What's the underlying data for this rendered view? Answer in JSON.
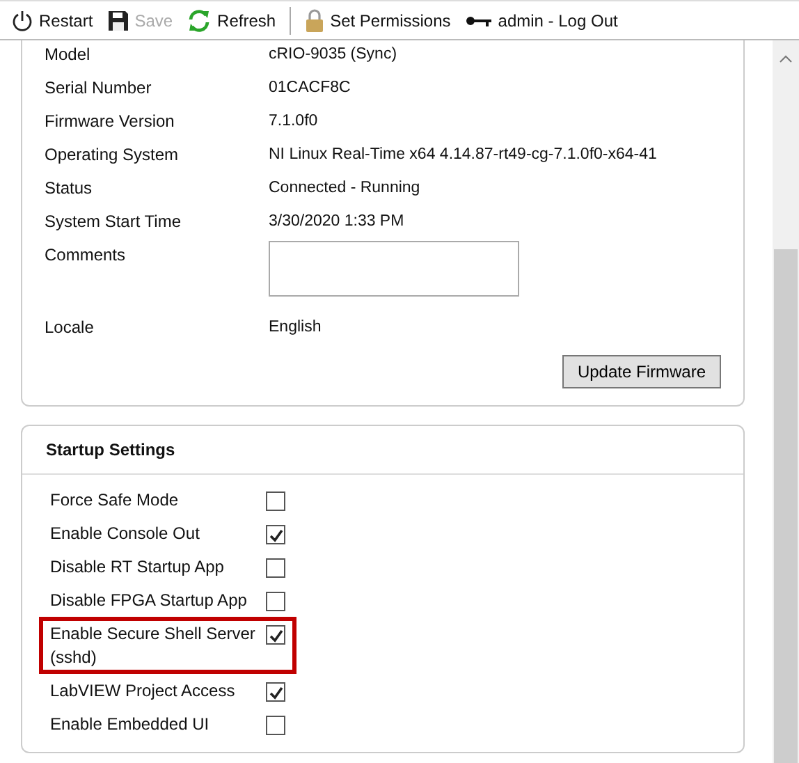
{
  "toolbar": [
    {
      "kind": "power",
      "label": "Restart",
      "disabled": false
    },
    {
      "kind": "save",
      "label": "Save",
      "disabled": true
    },
    {
      "kind": "refresh",
      "label": "Refresh",
      "disabled": false
    },
    {
      "kind": "lock",
      "label": "Set Permissions",
      "disabled": false
    },
    {
      "kind": "key",
      "label": "admin - Log Out",
      "disabled": false
    }
  ],
  "system_info": {
    "rows": [
      {
        "kind": "text",
        "label": "Model",
        "value": "cRIO-9035 (Sync)"
      },
      {
        "kind": "text",
        "label": "Serial Number",
        "value": "01CACF8C"
      },
      {
        "kind": "text",
        "label": "Firmware Version",
        "value": "7.1.0f0"
      },
      {
        "kind": "text",
        "label": "Operating System",
        "value": "NI Linux Real-Time x64 4.14.87-rt49-cg-7.1.0f0-x64-41"
      },
      {
        "kind": "text",
        "label": "Status",
        "value": "Connected - Running"
      },
      {
        "kind": "text",
        "label": "System Start Time",
        "value": "3/30/2020 1:33 PM"
      },
      {
        "kind": "field",
        "label": "Comments"
      },
      {
        "kind": "text",
        "label": "Locale",
        "value": "English"
      }
    ],
    "button": "Update Firmware"
  },
  "startup_settings": {
    "title": "Startup Settings",
    "items": [
      {
        "label": "Force Safe Mode",
        "checked": false,
        "highlighted": false
      },
      {
        "label": "Enable Console Out",
        "checked": true,
        "highlighted": false
      },
      {
        "label": "Disable RT Startup App",
        "checked": false,
        "highlighted": false
      },
      {
        "label": "Disable FPGA Startup App",
        "checked": false,
        "highlighted": false
      },
      {
        "label": "Enable Secure Shell Server (sshd)",
        "checked": true,
        "highlighted": true
      },
      {
        "label": "LabVIEW Project Access",
        "checked": true,
        "highlighted": false
      },
      {
        "label": "Enable Embedded UI",
        "checked": false,
        "highlighted": false
      }
    ]
  }
}
